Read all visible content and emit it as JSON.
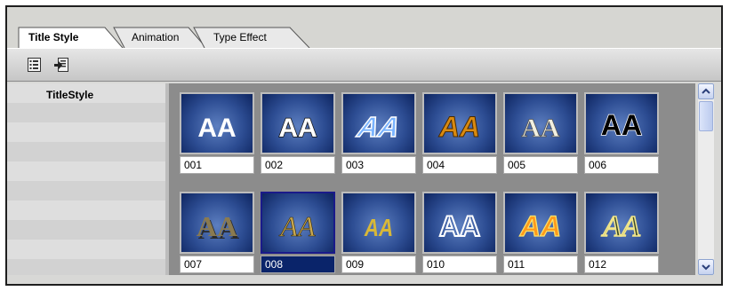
{
  "tabs": [
    {
      "label": "Title Style",
      "active": true
    },
    {
      "label": "Animation",
      "active": false
    },
    {
      "label": "Type Effect",
      "active": false
    }
  ],
  "toolbar": {
    "buttons": [
      {
        "icon": "properties-icon"
      },
      {
        "icon": "import-icon"
      }
    ]
  },
  "list": {
    "header": "TitleStyle"
  },
  "gallery": {
    "items": [
      {
        "label": "001",
        "glyph": "AA"
      },
      {
        "label": "002",
        "glyph": "AA"
      },
      {
        "label": "003",
        "glyph": "AA"
      },
      {
        "label": "004",
        "glyph": "AA"
      },
      {
        "label": "005",
        "glyph": "AA"
      },
      {
        "label": "006",
        "glyph": "AA"
      },
      {
        "label": "007",
        "glyph": "AA"
      },
      {
        "label": "008",
        "glyph": "AA",
        "selected": true
      },
      {
        "label": "009",
        "glyph": "AA"
      },
      {
        "label": "010",
        "glyph": "AA"
      },
      {
        "label": "011",
        "glyph": "AA"
      },
      {
        "label": "012",
        "glyph": "AA"
      }
    ]
  },
  "colors": {
    "selection": "#0a246a",
    "thumb_bg": "#2d4d93"
  }
}
